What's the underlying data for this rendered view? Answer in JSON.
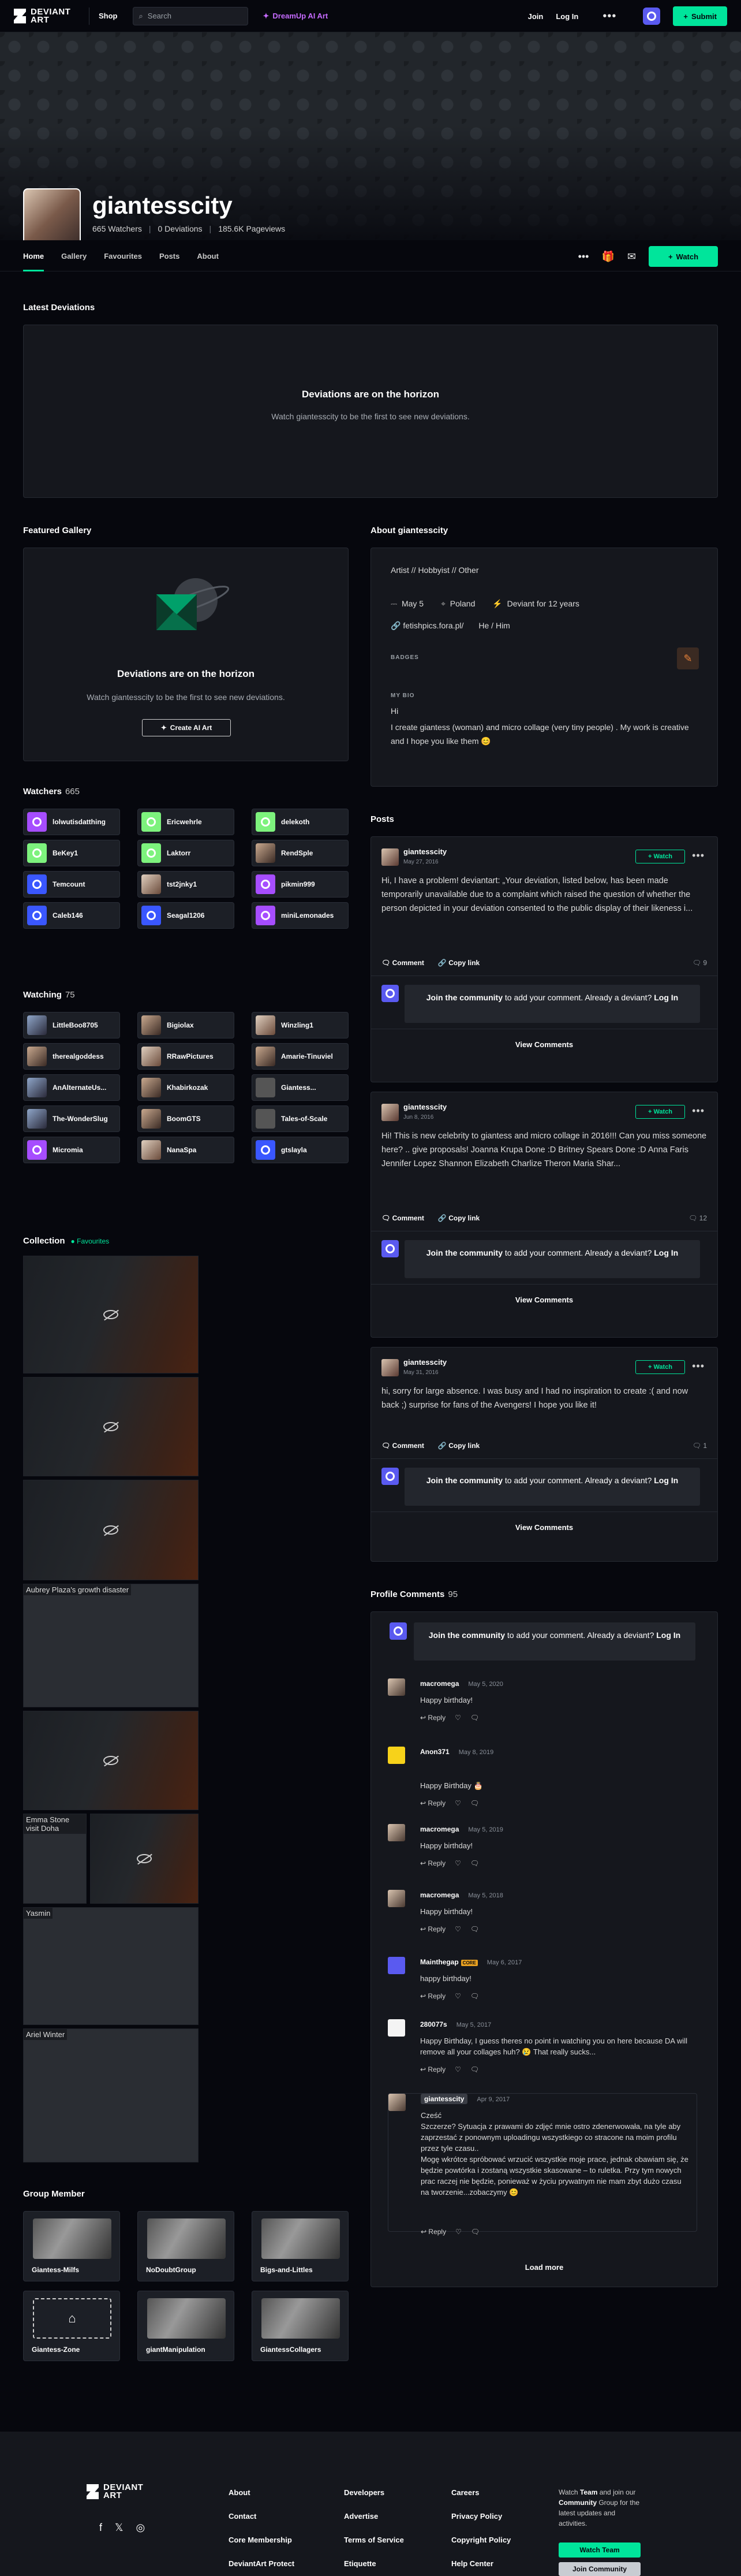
{
  "topbar": {
    "brand": "DEVIANT ART",
    "shop": "Shop",
    "search_placeholder": "Search",
    "dreamup": "DreamUp AI Art",
    "join": "Join",
    "login": "Log In",
    "submit": "Submit"
  },
  "profile": {
    "name": "giantesscity",
    "watchers": "665 Watchers",
    "deviations": "0 Deviations",
    "pageviews": "185.6K Pageviews"
  },
  "nav": {
    "tabs": [
      "Home",
      "Gallery",
      "Favourites",
      "Posts",
      "About"
    ],
    "watch": "Watch"
  },
  "latest": {
    "title": "Latest Deviations",
    "empty_title": "Deviations are on the horizon",
    "empty_sub": "Watch giantesscity to be the first to see new deviations."
  },
  "featured": {
    "title": "Featured Gallery",
    "empty_title": "Deviations are on the horizon",
    "empty_sub": "Watch giantesscity to be the first to see new deviations.",
    "cta": "Create AI Art"
  },
  "about": {
    "title": "About giantesscity",
    "roles": "Artist  //  Hobbyist  //  Other",
    "birthday": "May 5",
    "country": "Poland",
    "deviant": "Deviant for 12 years",
    "link": "fetishpics.fora.pl/",
    "pronouns": "He / Him",
    "badges": "BADGES",
    "bio_label": "MY BIO",
    "bio_hi": "Hi",
    "bio_text": "I create giantess (woman) and micro collage (very tiny people) . My work is creative and I hope you like them 😊"
  },
  "watchers": {
    "title": "Watchers",
    "count": "665",
    "users": [
      {
        "name": "lolwutisdatthing",
        "c": "p"
      },
      {
        "name": "Ericwehrle",
        "c": "g"
      },
      {
        "name": "delekoth",
        "c": "g"
      },
      {
        "name": "BeKey1",
        "c": "g"
      },
      {
        "name": "Laktorr",
        "c": "g"
      },
      {
        "name": "RendSple",
        "c": "ph"
      },
      {
        "name": "Temcount",
        "c": "b"
      },
      {
        "name": "tst2jnky1",
        "c": "ph3"
      },
      {
        "name": "pikmin999",
        "c": "p"
      },
      {
        "name": "Caleb146",
        "c": "b"
      },
      {
        "name": "Seagal1206",
        "c": "b"
      },
      {
        "name": "miniLemonades",
        "c": "p"
      }
    ]
  },
  "watching": {
    "title": "Watching",
    "count": "75",
    "users": [
      {
        "name": "LittleBoo8705",
        "c": "ph2"
      },
      {
        "name": "Bigiolax",
        "c": "ph"
      },
      {
        "name": "Winzling1",
        "c": "ph3"
      },
      {
        "name": "therealgoddess",
        "c": "ph"
      },
      {
        "name": "RRawPictures",
        "c": "ph3"
      },
      {
        "name": "Amarie-Tinuviel",
        "c": "ph"
      },
      {
        "name": "AnAlternateUs...",
        "c": "ph2"
      },
      {
        "name": "Khabirkozak",
        "c": "ph"
      },
      {
        "name": "Giantess...",
        "c": "gr"
      },
      {
        "name": "The-WonderSlug",
        "c": "ph2"
      },
      {
        "name": "BoomGTS",
        "c": "ph"
      },
      {
        "name": "Tales-of-Scale",
        "c": "gr"
      },
      {
        "name": "Micromia",
        "c": "p"
      },
      {
        "name": "NanaSpa",
        "c": "ph3"
      },
      {
        "name": "gtslayla",
        "c": "b"
      }
    ]
  },
  "collection": {
    "title": "Collection",
    "tag": "Favourites",
    "alts": [
      "Aubrey Plaza's growth disaster",
      "Emma Stone visit Doha",
      "Yasmin",
      "Ariel Winter"
    ]
  },
  "groups": {
    "title": "Group Member",
    "items": [
      "Giantess-Milfs",
      "NoDoubtGroup",
      "Bigs-and-Littles",
      "Giantess-Zone",
      "giantManipulation",
      "GiantessCollagers"
    ]
  },
  "posts": {
    "title": "Posts",
    "author": "giantesscity",
    "watch": "Watch",
    "comment": "Comment",
    "copy_link": "Copy link",
    "join_a": "Join the community",
    "join_b": " to add your comment. Already a deviant? ",
    "login": "Log In",
    "view": "View Comments",
    "items": [
      {
        "date": "May 27, 2016",
        "text": "Hi, I have a problem! deviantart: „Your deviation, listed below, has been made temporarily unavailable due to a complaint which raised the question of whether the person depicted in your deviation consented to the public display of their likeness i...",
        "count": "9"
      },
      {
        "date": "Jun 8, 2016",
        "text": "Hi! This is new celebrity to giantess and micro collage in 2016!!! Can you miss someone here? .. give proposals! Joanna Krupa          Done :D Britney Spears          Done :D Anna Faris Jennifer Lopez Shannon Elizabeth Charlize Theron Maria Shar...",
        "count": "12"
      },
      {
        "date": "May 31, 2016",
        "text": "hi, sorry for large absence. I was busy and I had no inspiration to create :( and now back ;) surprise for fans of the Avengers! I hope you like it!",
        "count": "1"
      }
    ]
  },
  "profile_comments": {
    "title": "Profile Comments",
    "count": "95",
    "join_a": "Join the community",
    "join_b": " to add your comment. Already a deviant? ",
    "login": "Log In",
    "reply": "Reply",
    "load_more": "Load more",
    "items": [
      {
        "name": "macromega",
        "date": "May 5, 2020",
        "text": "Happy birthday!"
      },
      {
        "name": "Anon371",
        "date": "May 8, 2019",
        "text": "Happy Birthday 🎂"
      },
      {
        "name": "macromega",
        "date": "May 5, 2019",
        "text": "Happy birthday!"
      },
      {
        "name": "macromega",
        "date": "May 5, 2018",
        "text": "Happy birthday!"
      },
      {
        "name": "Mainthegap",
        "date": "May 6, 2017",
        "text": "happy birthday!",
        "badge": "CORE"
      },
      {
        "name": "280077s",
        "date": "May 5, 2017",
        "text": "Happy Birthday, I guess theres no point in watching you on here because DA will remove all your collages huh? 😢 That really sucks..."
      },
      {
        "name": "giantesscity",
        "date": "Apr 9, 2017",
        "text": "Cześć\nSzczerze? Sytuacja z prawami do zdjęć mnie ostro zdenerwowała, na tyle aby zaprzestać z ponownym uploadingu wszystkiego co stracone na moim profilu przez tyle czasu..\nMogę wkrótce spróbować wrzucić wszystkie moje prace, jednak obawiam się, że będzie powtórka i zostaną wszystkie skasowane – to ruletka. Przy tym nowych prac raczej nie będzie, ponieważ w życiu prywatnym nie mam zbyt dużo czasu na tworzenie...zobaczymy 😊"
      }
    ]
  },
  "footer": {
    "brand": "DEVIANT ART",
    "col1": [
      "About",
      "Contact",
      "Core Membership",
      "DeviantArt Protect"
    ],
    "col2": [
      "Developers",
      "Advertise",
      "Terms of Service",
      "Etiquette"
    ],
    "col3": [
      "Careers",
      "Privacy Policy",
      "Copyright Policy",
      "Help Center"
    ],
    "promo_a": "Watch ",
    "promo_team": "Team",
    "promo_b": " and join our ",
    "promo_comm": "Community",
    "promo_c": " Group for the latest updates and activities.",
    "watch_team": "Watch Team",
    "join_comm": "Join Community"
  },
  "colors": {
    "accent": "#00e59b",
    "background": "#06070d",
    "panel": "#15171d",
    "dreamup": "#c66bff"
  }
}
